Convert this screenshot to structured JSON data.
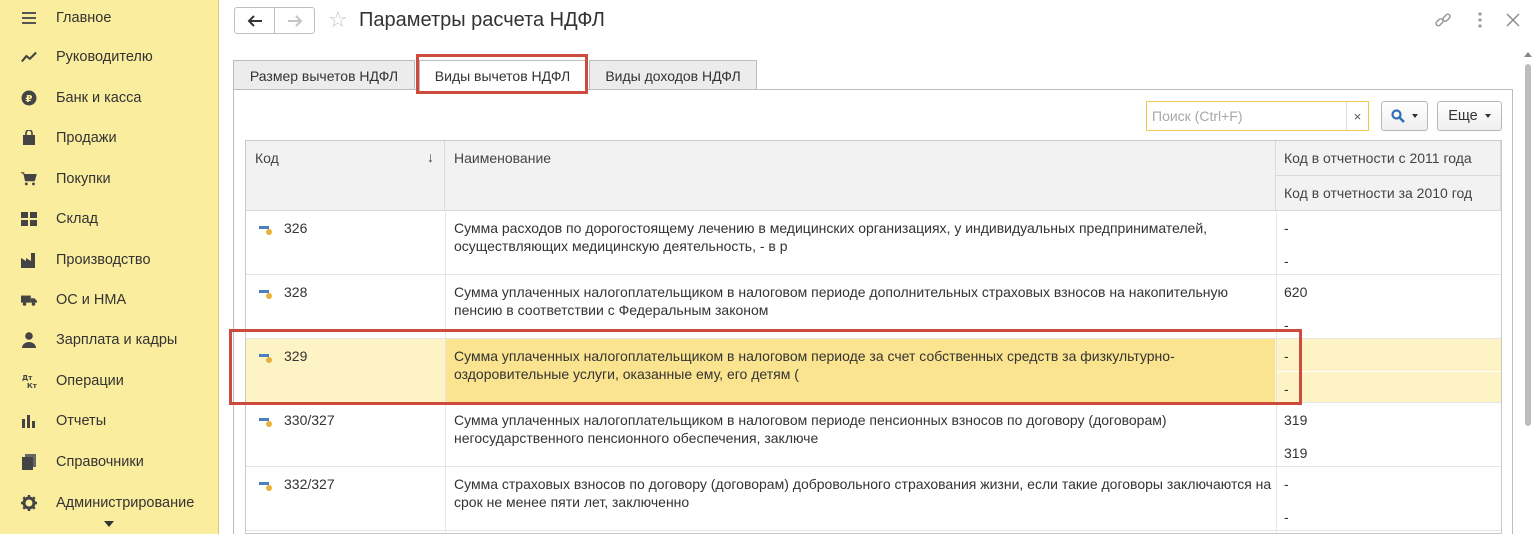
{
  "sidebar": {
    "items": [
      {
        "label": "Главное",
        "icon": "menu-icon"
      },
      {
        "label": "Руководителю",
        "icon": "trend-chart-icon"
      },
      {
        "label": "Банк и касса",
        "icon": "ruble-coin-icon"
      },
      {
        "label": "Продажи",
        "icon": "shopping-bag-icon"
      },
      {
        "label": "Покупки",
        "icon": "shopping-cart-icon"
      },
      {
        "label": "Склад",
        "icon": "warehouse-grid-icon"
      },
      {
        "label": "Производство",
        "icon": "factory-icon"
      },
      {
        "label": "ОС и НМА",
        "icon": "truck-icon"
      },
      {
        "label": "Зарплата и кадры",
        "icon": "person-icon"
      },
      {
        "label": "Операции",
        "icon": "dt-kt-icon"
      },
      {
        "label": "Отчеты",
        "icon": "bar-chart-icon"
      },
      {
        "label": "Справочники",
        "icon": "books-icon"
      },
      {
        "label": "Администрирование",
        "icon": "gear-icon"
      }
    ]
  },
  "window": {
    "title": "Параметры расчета НДФЛ"
  },
  "tabs": [
    {
      "label": "Размер вычетов НДФЛ",
      "active": false
    },
    {
      "label": "Виды вычетов НДФЛ",
      "active": true
    },
    {
      "label": "Виды доходов НДФЛ",
      "active": false
    }
  ],
  "toolbar": {
    "search_placeholder": "Поиск (Ctrl+F)",
    "search_clear": "×",
    "more_label": "Еще"
  },
  "table": {
    "headers": {
      "code": "Код",
      "sort_arrow": "↓",
      "name": "Наименование",
      "code_2011": "Код в отчетности с 2011 года",
      "code_2010": "Код в отчетности за 2010 год"
    },
    "rows": [
      {
        "code": "326",
        "name": "Сумма расходов по дорогостоящему лечению в медицинских организациях, у индивидуальных предпринимателей, осуществляющих медицинскую деятельность, - в р",
        "code_2011": "-",
        "code_2010": "-",
        "selected": false
      },
      {
        "code": "328",
        "name": "Сумма уплаченных налогоплательщиком в налоговом периоде дополнительных страховых взносов на накопительную пенсию в соответствии с Федеральным законом",
        "code_2011": "620",
        "code_2010": "-",
        "selected": false
      },
      {
        "code": "329",
        "name": "Сумма уплаченных налогоплательщиком в налоговом периоде за счет собственных средств за физкультурно-оздоровительные услуги, оказанные ему, его детям (",
        "code_2011": "-",
        "code_2010": "-",
        "selected": true
      },
      {
        "code": "330/327",
        "name": "Сумма уплаченных налогоплательщиком в налоговом периоде пенсионных взносов по договору (договорам) негосударственного пенсионного обеспечения, заключе",
        "code_2011": "319",
        "code_2010": "319",
        "selected": false
      },
      {
        "code": "332/327",
        "name": "Сумма страховых взносов по договору (договорам) добровольного страхования жизни, если такие договоры заключаются на срок не менее пяти лет, заключенно",
        "code_2011": "-",
        "code_2010": "-",
        "selected": false
      }
    ]
  },
  "colors": {
    "sidebar_bg": "#fbed9e",
    "highlight_red": "#cc4b3d",
    "selected_row": "#fdf3c4",
    "selected_cell": "#fbe48f",
    "search_border": "#f0c64c",
    "search_icon": "#2f6fb8"
  }
}
